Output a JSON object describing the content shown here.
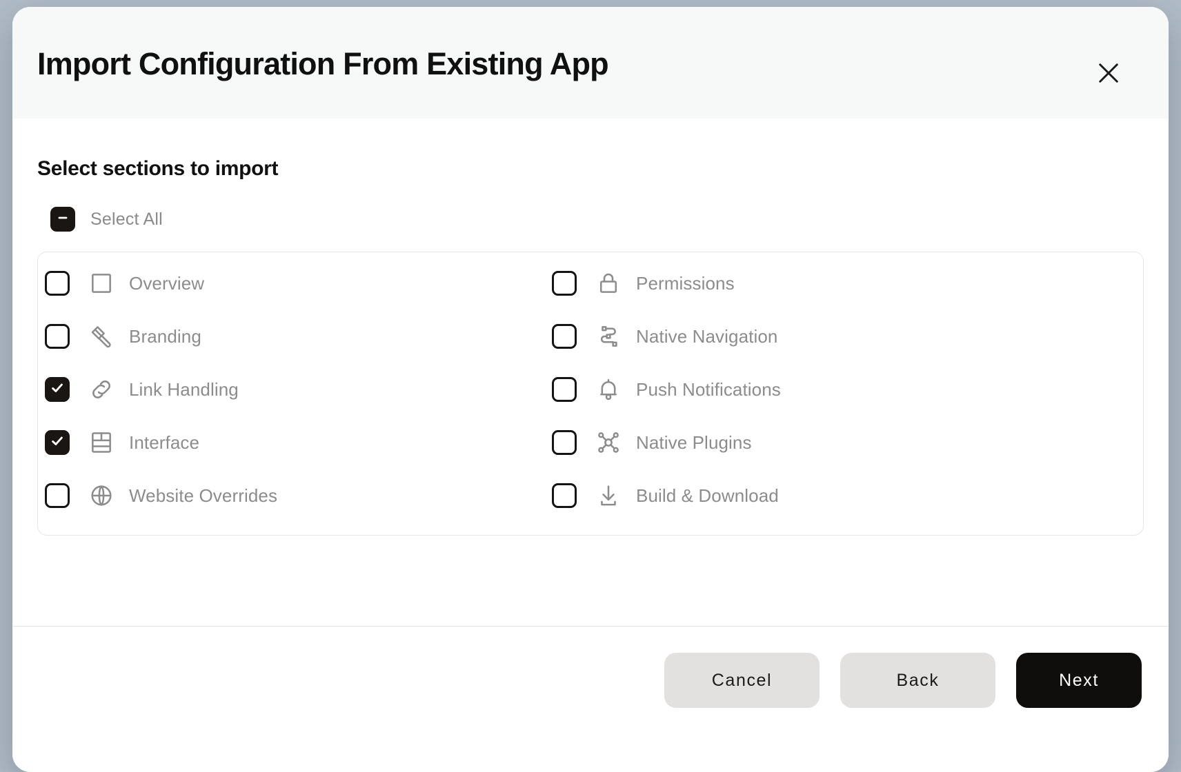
{
  "dialog": {
    "title": "Import Configuration From Existing App",
    "close_label": "Close",
    "close_icon": "close-icon"
  },
  "body": {
    "heading": "Select sections to import",
    "select_all": {
      "label": "Select All",
      "state": "indeterminate"
    },
    "sections": [
      {
        "label": "Overview",
        "icon": "square-icon",
        "checked": false,
        "column": "left",
        "index": 0
      },
      {
        "label": "Branding",
        "icon": "paintbrush-icon",
        "checked": false,
        "column": "left",
        "index": 1
      },
      {
        "label": "Link Handling",
        "icon": "link-icon",
        "checked": true,
        "column": "left",
        "index": 2
      },
      {
        "label": "Interface",
        "icon": "layout-grid-icon",
        "checked": true,
        "column": "left",
        "index": 3
      },
      {
        "label": "Website Overrides",
        "icon": "globe-icon",
        "checked": false,
        "column": "left",
        "index": 4
      },
      {
        "label": "Permissions",
        "icon": "lock-icon",
        "checked": false,
        "column": "right",
        "index": 0
      },
      {
        "label": "Native Navigation",
        "icon": "flow-nodes-icon",
        "checked": false,
        "column": "right",
        "index": 1
      },
      {
        "label": "Push Notifications",
        "icon": "bell-icon",
        "checked": false,
        "column": "right",
        "index": 2
      },
      {
        "label": "Native Plugins",
        "icon": "hub-network-icon",
        "checked": false,
        "column": "right",
        "index": 3
      },
      {
        "label": "Build & Download",
        "icon": "download-icon",
        "checked": false,
        "column": "right",
        "index": 4
      }
    ]
  },
  "footer": {
    "cancel_label": "Cancel",
    "back_label": "Back",
    "next_label": "Next"
  },
  "colors": {
    "backdrop": "#b2bdc9",
    "header_bg": "#f7f8f8",
    "surface": "#ffffff",
    "accent": "#100e0c",
    "muted_text": "#8c8c8c",
    "secondary_button": "#e2e1df",
    "panel_border": "#e6e6e6"
  }
}
